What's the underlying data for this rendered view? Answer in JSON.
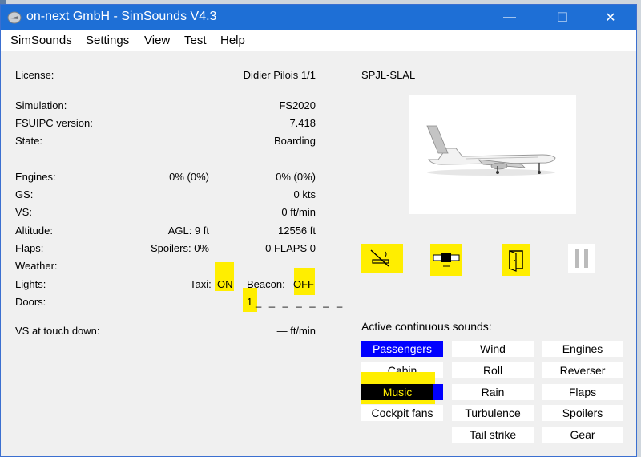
{
  "window": {
    "title": "on-next GmbH - SimSounds V4.3",
    "controls": {
      "minimize": "—",
      "maximize": "☐",
      "close": "✕"
    }
  },
  "menu": [
    "SimSounds",
    "Settings",
    "View",
    "Test",
    "Help"
  ],
  "info": {
    "license_label": "License:",
    "license_value": "Didier Pilois 1/1",
    "simulation_label": "Simulation:",
    "simulation_value": "FS2020",
    "fsuipc_label": "FSUIPC version:",
    "fsuipc_value": "7.418",
    "state_label": "State:",
    "state_value": "Boarding",
    "engines_label": "Engines:",
    "engines_mid": "0% (0%)",
    "engines_right": "0% (0%)",
    "gs_label": "GS:",
    "gs_value": "0 kts",
    "vs_label": "VS:",
    "vs_value": "0 ft/min",
    "altitude_label": "Altitude:",
    "altitude_mid": "AGL: 9 ft",
    "altitude_right": "12556 ft",
    "flaps_label": "Flaps:",
    "flaps_mid": "Spoilers: 0%",
    "flaps_right": "0 FLAPS 0",
    "weather_label": "Weather:",
    "lights_label": "Lights:",
    "taxi_label": "Taxi:",
    "taxi_value": "ON",
    "beacon_label": "Beacon:",
    "beacon_value": "OFF",
    "doors_label": "Doors:",
    "doors_value": "1",
    "vs_touchdown_label": "VS at touch down:",
    "vs_touchdown_value": "— ft/min"
  },
  "aircraft": {
    "route": "SPJL-SLAL"
  },
  "icons": [
    "no-smoking-icon",
    "seatbelt-icon",
    "door-icon",
    "pause-icon"
  ],
  "sounds": {
    "header": "Active continuous sounds:",
    "col1": [
      "Passengers",
      "Cabin",
      "Music",
      "Cockpit fans"
    ],
    "col2": [
      "Wind",
      "Roll",
      "Rain",
      "Turbulence",
      "Tail strike"
    ],
    "col3": [
      "Engines",
      "Reverser",
      "Flaps",
      "Spoilers",
      "Gear"
    ]
  },
  "colors": {
    "titlebar": "#1e6fd6",
    "active_blue": "#0000ff",
    "highlight": "#ffee00"
  }
}
